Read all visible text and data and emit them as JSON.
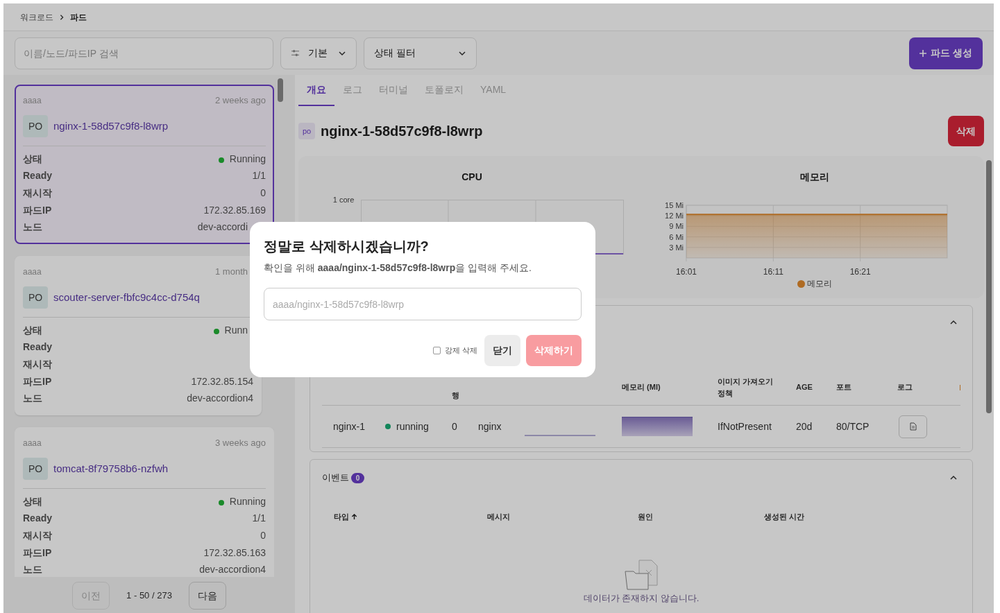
{
  "breadcrumb": [
    "워크로드",
    "파드"
  ],
  "toolbar": {
    "search": {
      "placeholder": "이름/노드/파드IP 검색"
    },
    "view_select": "기본",
    "status_filter": "상태 필터",
    "create_button": "파드 생성"
  },
  "pods": [
    {
      "namespace": "aaaa",
      "age": "2 weeks ago",
      "kind": "PO",
      "name": "nginx-1-58d57c9f8-l8wrp",
      "selected": true,
      "fields": [
        {
          "label": "상태",
          "value": "Running",
          "color": "#1a8a2a"
        },
        {
          "label": "Ready",
          "value": "1/1"
        },
        {
          "label": "재시작",
          "value": "0"
        },
        {
          "label": "파드IP",
          "value": "172.32.85.169"
        },
        {
          "label": "노드",
          "value": "dev-accordi"
        }
      ]
    },
    {
      "namespace": "aaaa",
      "age": "1 month",
      "kind": "PO",
      "name": "scouter-server-fbfc9c4cc-d754q",
      "selected": false,
      "fields": [
        {
          "label": "상태",
          "value": "Runn",
          "color": "#1a8a2a"
        },
        {
          "label": "Ready"
        },
        {
          "label": "재시작"
        },
        {
          "label": "파드IP",
          "value": "172.32.85.154"
        },
        {
          "label": "노드",
          "value": "dev-accordion4"
        }
      ]
    },
    {
      "namespace": "aaaa",
      "age": "3 weeks ago",
      "kind": "PO",
      "name": "tomcat-8f79758b6-nzfwh",
      "selected": false,
      "fields": [
        {
          "label": "상태",
          "value": "Running",
          "color": "#1a8a2a"
        },
        {
          "label": "Ready",
          "value": "1/1"
        },
        {
          "label": "재시작",
          "value": "0"
        },
        {
          "label": "파드IP",
          "value": "172.32.85.163"
        },
        {
          "label": "노드",
          "value": "dev-accordion4"
        }
      ]
    }
  ],
  "pagination": {
    "prev": "이전",
    "range": "1 - 50 / 273",
    "next": "다음",
    "prev_disabled": true
  },
  "tabs": [
    {
      "label": "개요",
      "selected": true
    },
    {
      "label": "로그",
      "selected": false
    },
    {
      "label": "터미널",
      "selected": false
    },
    {
      "label": "토폴로지",
      "selected": false
    },
    {
      "label": "YAML",
      "selected": false
    }
  ],
  "detail": {
    "kind": "po",
    "title": "nginx-1-58d57c9f8-l8wrp",
    "delete_button": "삭제"
  },
  "cpu_chart": {
    "title": "CPU",
    "y_tick": "1 core"
  },
  "memory_chart": {
    "title": "메모리",
    "chart_data": {
      "type": "area",
      "grid": true,
      "categories": [
        "16:01",
        "16:11",
        "16:21",
        null
      ],
      "ylim": [
        0,
        15
      ],
      "yticks": [
        {
          "value": 3,
          "label": "3 Mi"
        },
        {
          "value": 6,
          "label": "6 Mi"
        },
        {
          "value": 9,
          "label": "9 Mi"
        },
        {
          "value": 12,
          "label": "12 Mi"
        },
        {
          "value": 15,
          "label": "15 Mi"
        }
      ],
      "series": [
        {
          "name": "메모리",
          "color": "#e08a2e",
          "values": [
            12.4,
            12.4,
            12.4,
            12.4
          ]
        }
      ]
    }
  },
  "containers": {
    "expanded": true,
    "header_fragment": "행",
    "headers": [
      "메모리 (MI)",
      "이미지 가져오기 정책",
      "AGE",
      "포트",
      "로그"
    ],
    "rows": [
      {
        "name": "nginx-1",
        "status": "running",
        "color": "#12855a",
        "restarts": "0",
        "image": "nginx",
        "pull_policy": "IfNotPresent",
        "age": "20d",
        "port": "80/TCP"
      }
    ]
  },
  "events": {
    "title": "이벤트",
    "count": "0",
    "expanded": true,
    "columns": [
      "타입",
      "메시지",
      "원인",
      "생성된 시간"
    ],
    "empty_text": "데이터가 존재하지 않습니다."
  },
  "dialog": {
    "title": "정말로 삭제하시겠습니까?",
    "message": "확인을 위해 **aaaa/nginx-1-58d57c9f8-l8wrp**을 입력해 주세요.",
    "input_placeholder": "aaaa/nginx-1-58d57c9f8-l8wrp",
    "force_delete": {
      "label": "강제 삭제",
      "checked": false
    },
    "close_button": "닫기",
    "confirm_button": {
      "label": "삭제하기",
      "disabled": true
    }
  }
}
